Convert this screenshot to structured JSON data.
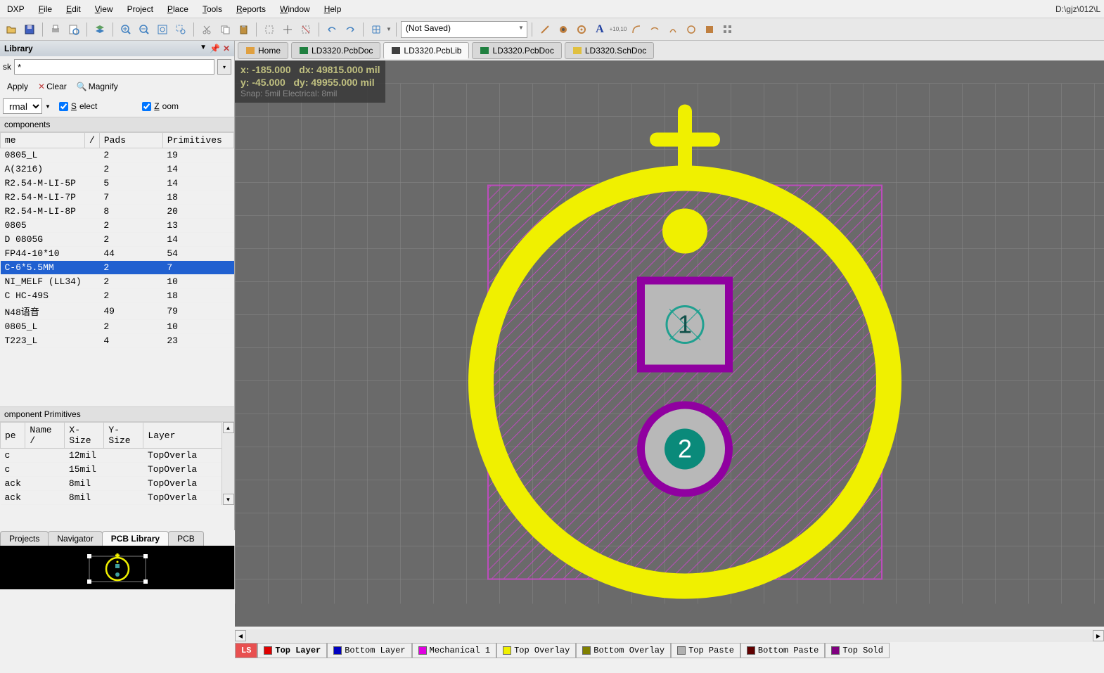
{
  "menubar": {
    "items": [
      "DXP",
      "File",
      "Edit",
      "View",
      "Project",
      "Place",
      "Tools",
      "Reports",
      "Window",
      "Help"
    ],
    "path": "D:\\gjz\\012\\L"
  },
  "toolbar1": {
    "dropdown_value": "(Not Saved)"
  },
  "library_panel": {
    "title": "Library",
    "mask_label": "sk",
    "mask_value": "*",
    "apply": "Apply",
    "clear": "Clear",
    "magnify": "Magnify",
    "normal": "rmal",
    "select": "Select",
    "zoom": "Zoom",
    "components_title": "components"
  },
  "components_table": {
    "headers": [
      "me",
      "/",
      "Pads",
      "Primitives"
    ],
    "rows": [
      {
        "name": "0805_L",
        "pads": "2",
        "prim": "19"
      },
      {
        "name": " A(3216)",
        "pads": "2",
        "prim": "14"
      },
      {
        "name": "R2.54-M-LI-5P",
        "pads": "5",
        "prim": "14"
      },
      {
        "name": "R2.54-M-LI-7P",
        "pads": "7",
        "prim": "18"
      },
      {
        "name": "R2.54-M-LI-8P",
        "pads": "8",
        "prim": "20"
      },
      {
        "name": "0805",
        "pads": "2",
        "prim": "13"
      },
      {
        "name": "D 0805G",
        "pads": "2",
        "prim": "14"
      },
      {
        "name": "FP44-10*10",
        "pads": "44",
        "prim": "54"
      },
      {
        "name": "C-6*5.5MM",
        "pads": "2",
        "prim": "7",
        "selected": true
      },
      {
        "name": "NI_MELF (LL34)",
        "pads": "2",
        "prim": "10"
      },
      {
        "name": "C HC-49S",
        "pads": "2",
        "prim": "18"
      },
      {
        "name": "N48语音",
        "pads": "49",
        "prim": "79"
      },
      {
        "name": "0805_L",
        "pads": "2",
        "prim": "10"
      },
      {
        "name": "T223_L",
        "pads": "4",
        "prim": "23"
      }
    ]
  },
  "primitives_table": {
    "title": "omponent Primitives",
    "headers": [
      "pe",
      "Name /",
      "X-Size",
      "Y-Size",
      "Layer"
    ],
    "rows": [
      {
        "type": "c",
        "name": "",
        "xsize": "12mil",
        "ysize": "",
        "layer": "TopOverla"
      },
      {
        "type": "c",
        "name": "",
        "xsize": "15mil",
        "ysize": "",
        "layer": "TopOverla"
      },
      {
        "type": "ack",
        "name": "",
        "xsize": "8mil",
        "ysize": "",
        "layer": "TopOverla"
      },
      {
        "type": "ack",
        "name": "",
        "xsize": "8mil",
        "ysize": "",
        "layer": "TopOverla"
      }
    ]
  },
  "bottom_tabs_left": [
    "Projects",
    "Navigator",
    "PCB Library",
    "PCB"
  ],
  "doc_tabs": [
    {
      "icon": "home",
      "label": "Home"
    },
    {
      "icon": "pcb",
      "label": "LD3320.PcbDoc"
    },
    {
      "icon": "pcblib",
      "label": "LD3320.PcbLib",
      "active": true
    },
    {
      "icon": "pcb",
      "label": "LD3320.PcbDoc"
    },
    {
      "icon": "sch",
      "label": "LD3320.SchDoc"
    }
  ],
  "coords": {
    "x": "x:  -185.000",
    "dx": "dx: 49815.000  mil",
    "y": "y:   -45.000",
    "dy": "dy: 49955.000  mil",
    "snap": "Snap: 5mil Electrical: 8mil"
  },
  "pads": {
    "p1": "1",
    "p2": "2"
  },
  "layer_tabs": [
    {
      "label": "LS",
      "cls": "ls"
    },
    {
      "swatch": "#e00000",
      "label": "Top Layer",
      "active": true
    },
    {
      "swatch": "#0000c0",
      "label": "Bottom Layer"
    },
    {
      "swatch": "#e000e0",
      "label": "Mechanical 1"
    },
    {
      "swatch": "#f0f000",
      "label": "Top Overlay"
    },
    {
      "swatch": "#808000",
      "label": "Bottom Overlay"
    },
    {
      "swatch": "#b0b0b0",
      "label": "Top Paste"
    },
    {
      "swatch": "#600000",
      "label": "Bottom Paste"
    },
    {
      "swatch": "#800080",
      "label": "Top Sold"
    }
  ]
}
